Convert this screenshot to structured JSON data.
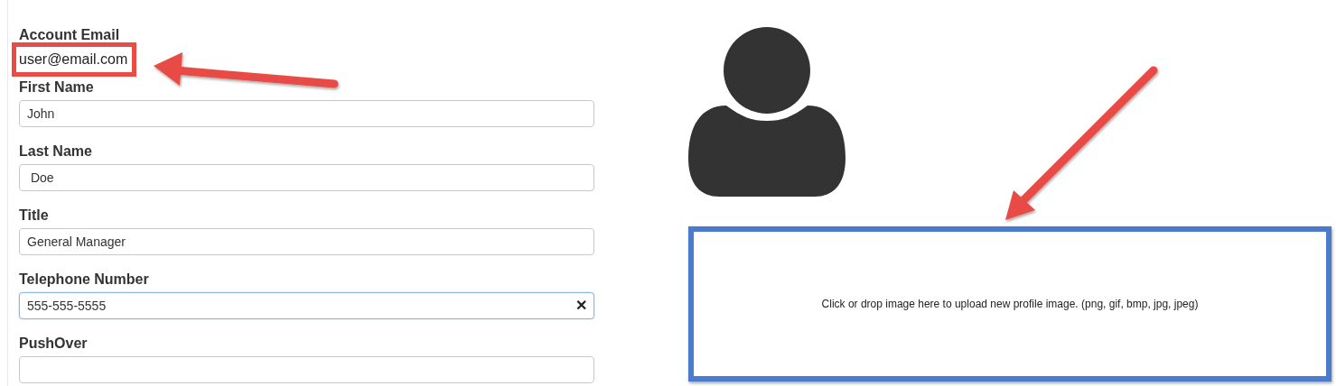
{
  "account": {
    "label": "Account Email",
    "email": "user@email.com",
    "highlighted": true
  },
  "fields": [
    {
      "label": "First Name",
      "value": "John",
      "focused": false
    },
    {
      "label": "Last Name",
      "value": " Doe",
      "focused": false
    },
    {
      "label": "Title",
      "value": "General Manager",
      "focused": false
    },
    {
      "label": "Telephone Number",
      "value": "555-555-5555",
      "focused": true,
      "clear_symbol": "✕"
    },
    {
      "label": "PushOver",
      "focused": false
    }
  ],
  "upload": {
    "text": "Click or drop image here to upload new profile image. (png, gif, bmp, jpg, jpeg)",
    "highlighted": true
  }
}
